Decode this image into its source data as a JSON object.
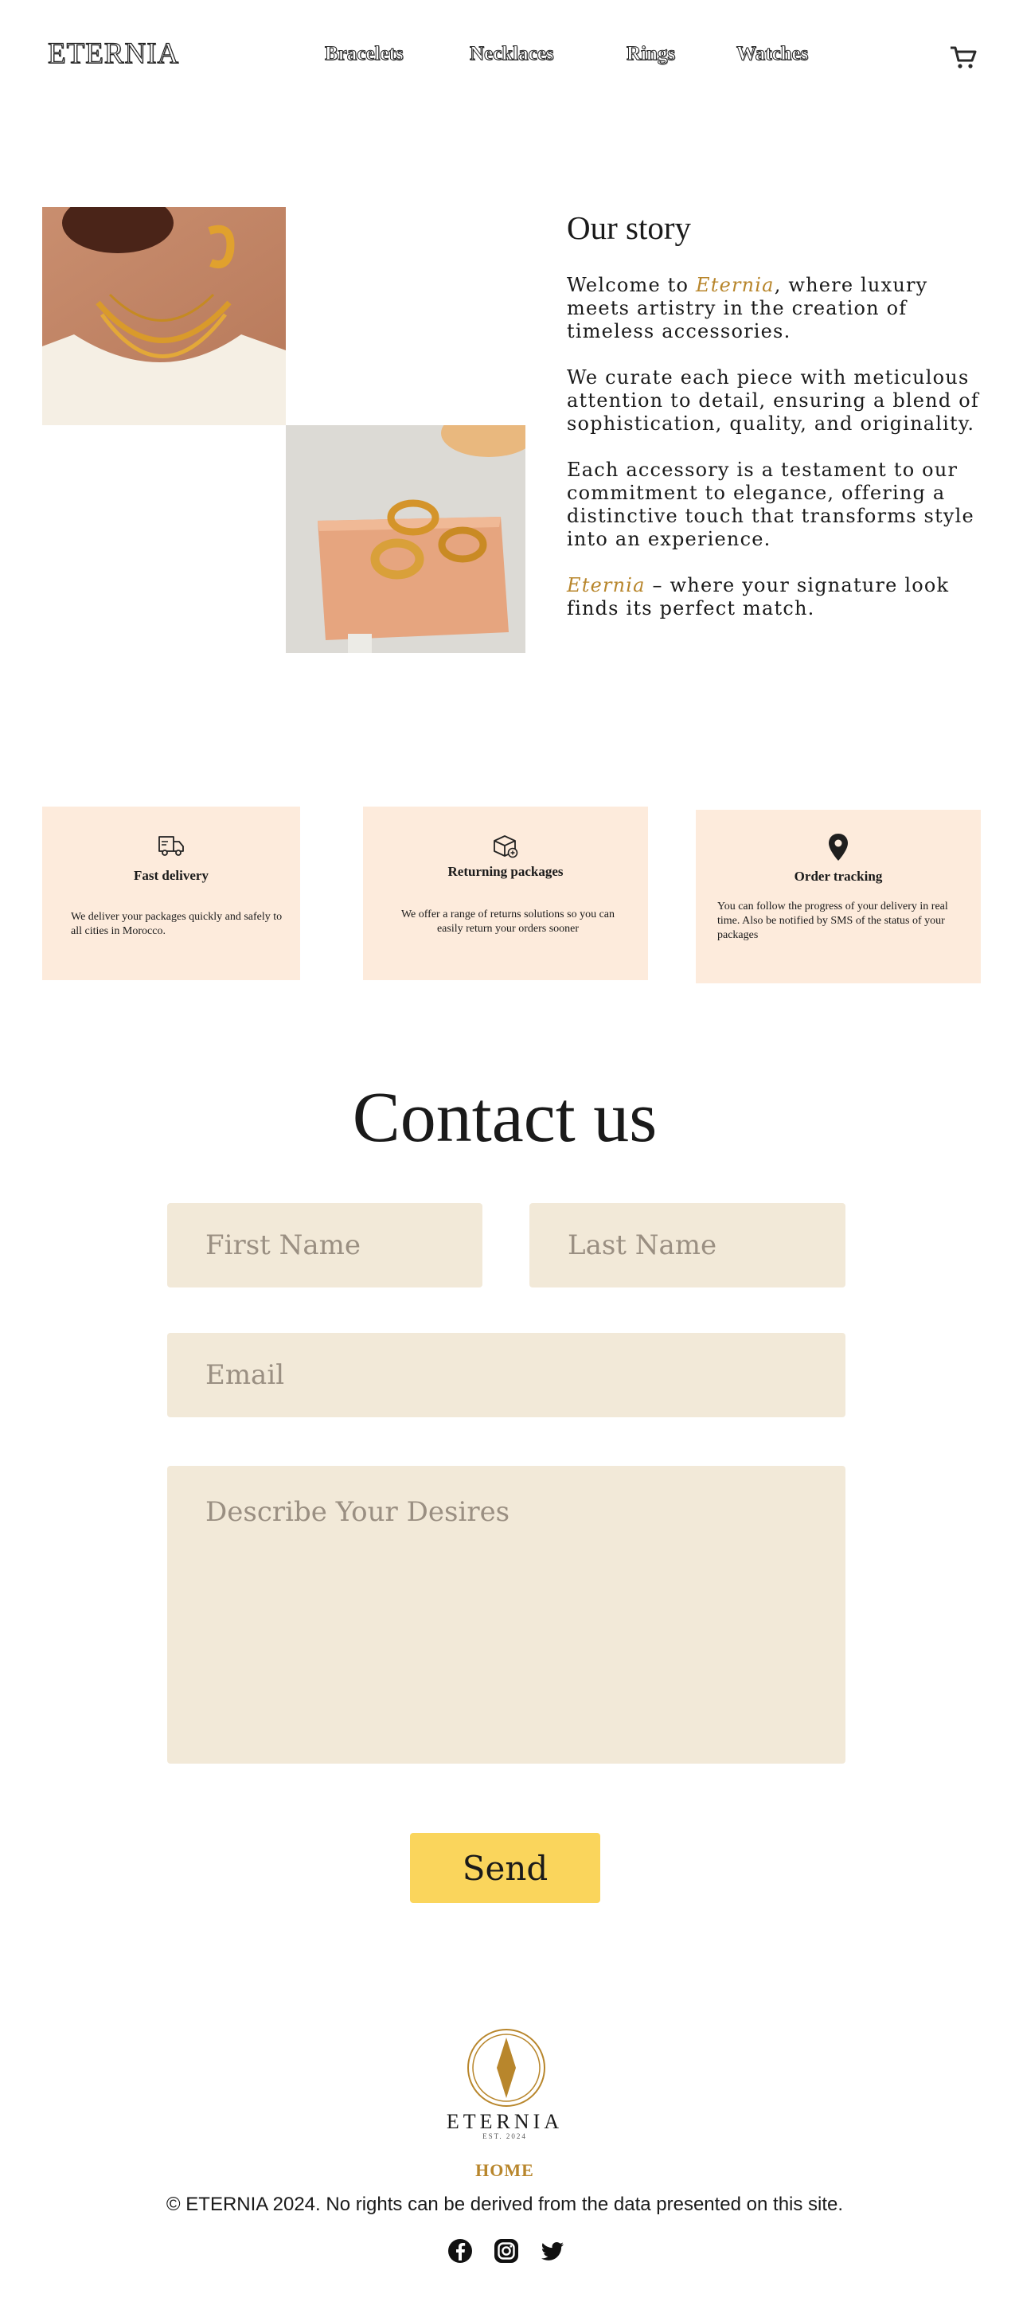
{
  "header": {
    "logo": "ETERNIA",
    "nav": [
      "Bracelets",
      "Necklaces",
      "Rings",
      "Watches"
    ],
    "cart_icon": "cart-icon"
  },
  "story": {
    "title": "Our story",
    "brand": "Eternia",
    "p1_before": "Welcome to ",
    "p1_after": ", where luxury meets artistry in the creation of timeless accessories.",
    "p2": "We curate each piece with meticulous attention to detail, ensuring a blend of sophistication, quality, and originality.",
    "p3": "Each accessory is a testament to our commitment to elegance, offering a distinctive touch that transforms style into an experience.",
    "p4_after": " – where your signature look finds its perfect match."
  },
  "features": [
    {
      "icon": "delivery-truck-icon",
      "title": "Fast  delivery",
      "text": "We deliver your packages quickly and safely to all cities in Morocco."
    },
    {
      "icon": "package-return-icon",
      "title": "Returning packages",
      "text": "We offer a range of returns solutions so you can easily return your orders sooner"
    },
    {
      "icon": "location-pin-icon",
      "title": "Order tracking",
      "text": "You can follow the progress of your delivery in real time. Also be notified by SMS of the status of your packages"
    }
  ],
  "contact": {
    "title": "Contact us",
    "first_name_placeholder": "First Name",
    "last_name_placeholder": "Last Name",
    "email_placeholder": "Email",
    "message_placeholder": "Describe Your Desires",
    "send_label": "Send"
  },
  "footer": {
    "brand": "ETERNIA",
    "est": "EST. 2024",
    "home": "HOME",
    "copyright": "© ETERNIA 2024.  No rights can be derived from the data presented on this site.",
    "social": [
      "facebook-icon",
      "instagram-icon",
      "twitter-icon"
    ]
  },
  "colors": {
    "accent_gold": "#b8862c",
    "field_bg": "#f2e9d8",
    "card_bg": "#fdebdc",
    "button_yellow": "#fad55c"
  }
}
